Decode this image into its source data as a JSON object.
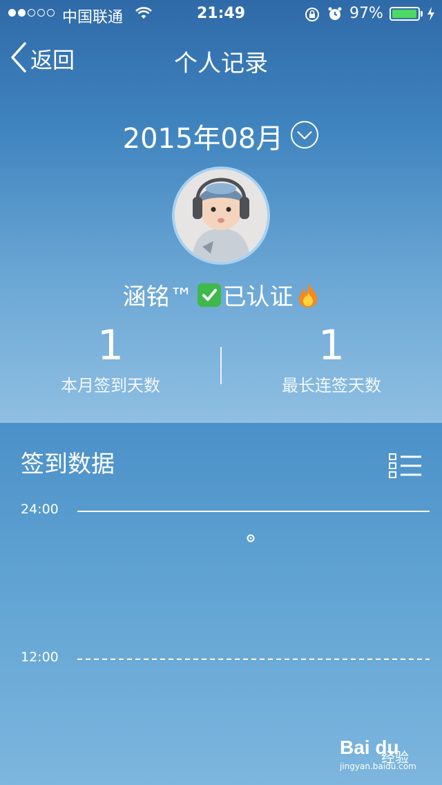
{
  "status_bar": {
    "carrier": "中国联通",
    "time": "21:49",
    "battery_percent": "97%",
    "battery_level": 0.97,
    "signal_bars": 2,
    "signal_total": 5,
    "battery_color": "#4cd964"
  },
  "nav": {
    "back_label": "返回",
    "title": "个人记录"
  },
  "month_selector": {
    "label": "2015年08月",
    "icon": "chevron-down-circle-icon"
  },
  "profile": {
    "name": "涵铭™",
    "verified_label": "已认证",
    "verified_icon": "check-box-icon",
    "badge_icon": "fire-icon"
  },
  "stats": [
    {
      "value": "1",
      "label": "本月签到天数"
    },
    {
      "value": "1",
      "label": "最长连签天数"
    }
  ],
  "section": {
    "title": "签到数据",
    "list_icon": "list-icon"
  },
  "chart_data": {
    "type": "scatter",
    "y_ticks": [
      "24:00",
      "12:00"
    ],
    "gridlines": [
      {
        "value": "24:00",
        "style": "solid"
      },
      {
        "value": "12:00",
        "style": "dashed"
      }
    ],
    "points": [
      {
        "y": "21:49"
      }
    ],
    "color": "#ffffff"
  },
  "watermark": {
    "brand": "Bai du",
    "sub": "经验",
    "url": "jingyan.baidu.com"
  }
}
